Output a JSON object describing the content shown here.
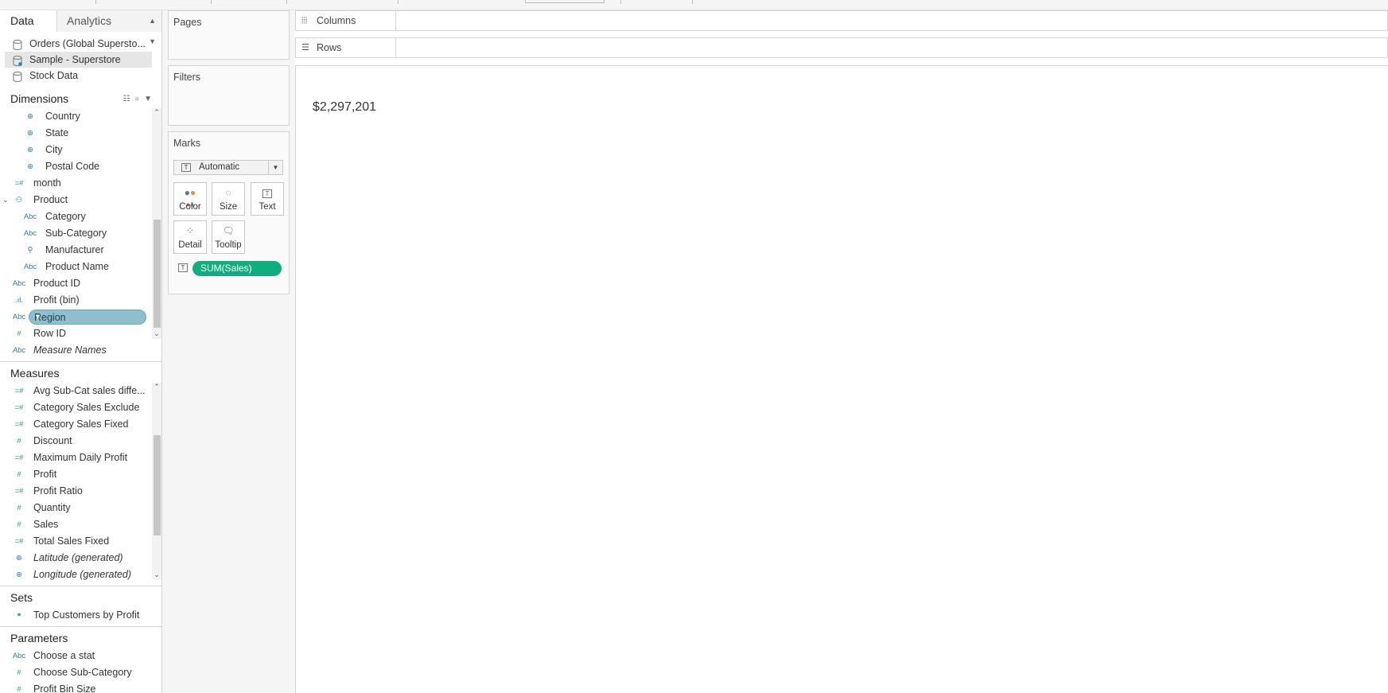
{
  "tabs": {
    "data": "Data",
    "analytics": "Analytics"
  },
  "datasources": [
    {
      "label": "Orders (Global Supersto...",
      "icon": "cylinder-icon",
      "selected": false
    },
    {
      "label": "Sample - Superstore",
      "icon": "live-cylinder-icon",
      "selected": true
    },
    {
      "label": "Stock Data",
      "icon": "multi-table-icon",
      "selected": false
    }
  ],
  "dimensions": {
    "title": "Dimensions",
    "items": [
      {
        "label": "Country",
        "type": "geo"
      },
      {
        "label": "State",
        "type": "geo"
      },
      {
        "label": "City",
        "type": "geo"
      },
      {
        "label": "Postal Code",
        "type": "geo"
      },
      {
        "label": "month",
        "type": "calc-number"
      },
      {
        "label": "Product",
        "type": "hierarchy"
      },
      {
        "label": "Category",
        "type": "string"
      },
      {
        "label": "Sub-Category",
        "type": "string"
      },
      {
        "label": "Manufacturer",
        "type": "group"
      },
      {
        "label": "Product Name",
        "type": "string"
      },
      {
        "label": "Product ID",
        "type": "string"
      },
      {
        "label": "Profit (bin)",
        "type": "bin"
      },
      {
        "label": "Region",
        "type": "string",
        "selected": true
      },
      {
        "label": "Row ID",
        "type": "number"
      },
      {
        "label": "Measure Names",
        "type": "string"
      }
    ]
  },
  "measures": {
    "title": "Measures",
    "items": [
      {
        "label": "Avg Sub-Cat sales diffe...",
        "type": "calc-number"
      },
      {
        "label": "Category Sales Exclude",
        "type": "calc-number"
      },
      {
        "label": "Category Sales Fixed",
        "type": "calc-number"
      },
      {
        "label": "Discount",
        "type": "number"
      },
      {
        "label": "Maximum Daily Profit",
        "type": "calc-number"
      },
      {
        "label": "Profit",
        "type": "number"
      },
      {
        "label": "Profit Ratio",
        "type": "calc-number"
      },
      {
        "label": "Quantity",
        "type": "number"
      },
      {
        "label": "Sales",
        "type": "number"
      },
      {
        "label": "Total Sales Fixed",
        "type": "calc-number"
      },
      {
        "label": "Latitude (generated)",
        "type": "geo"
      },
      {
        "label": "Longitude (generated)",
        "type": "geo"
      }
    ]
  },
  "sets": {
    "title": "Sets",
    "items": [
      "Top Customers by Profit"
    ]
  },
  "parameters": {
    "title": "Parameters",
    "items": [
      {
        "label": "Choose a stat",
        "type": "string"
      },
      {
        "label": "Choose Sub-Category",
        "type": "number"
      },
      {
        "label": "Profit Bin Size",
        "type": "number"
      }
    ]
  },
  "cards": {
    "pages": "Pages",
    "filters": "Filters",
    "marks": "Marks",
    "mark_type": "Automatic",
    "buttons": {
      "color": "Color",
      "size": "Size",
      "text": "Text",
      "detail": "Detail",
      "tooltip": "Tooltip"
    },
    "text_pill": "SUM(Sales)"
  },
  "shelves": {
    "columns": "Columns",
    "rows": "Rows"
  },
  "view": {
    "value": "$2,297,201"
  },
  "colors": {
    "dimension_blue": "#2f7e9c",
    "measure_green": "#22a083",
    "pill_green": "#0fae7e",
    "pill_blue": "#8fbfcf"
  }
}
